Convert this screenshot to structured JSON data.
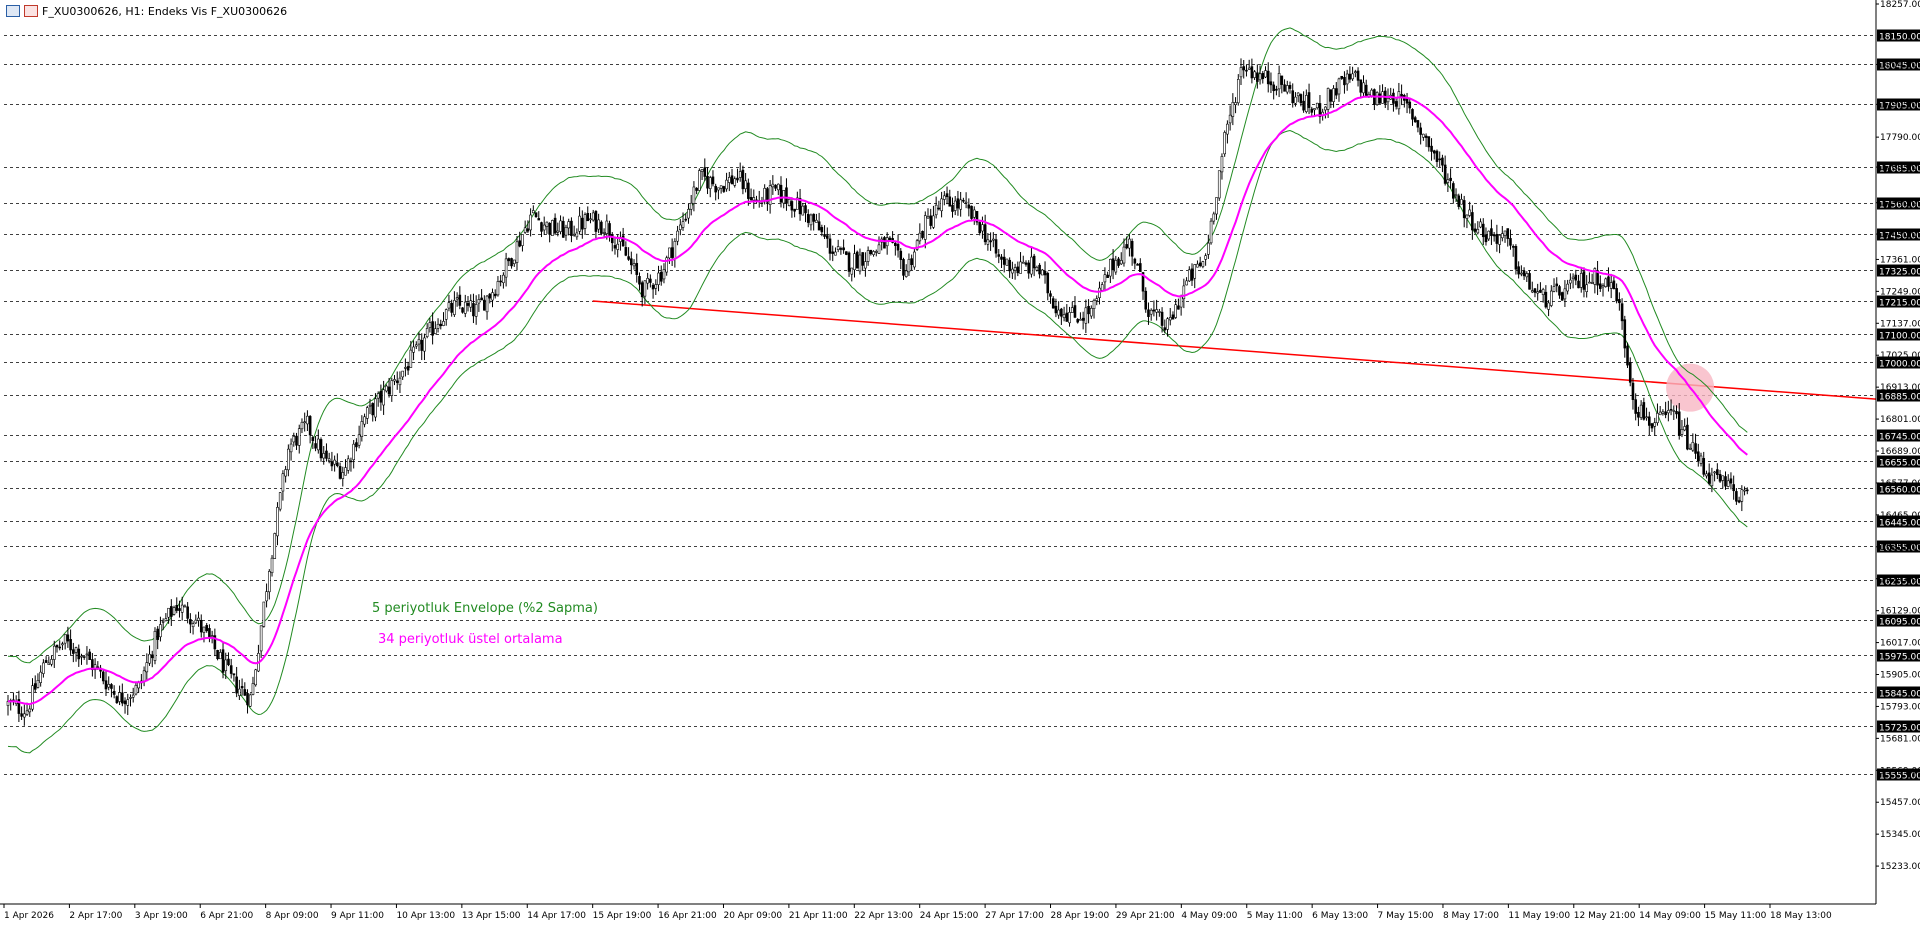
{
  "window": {
    "title": "F_XU0300626, H1:  Endeks Vis F_XU0300626",
    "icons": [
      "chart-icon",
      "indicator-icon"
    ]
  },
  "colors": {
    "candle": "#000000",
    "envelope": "#228b22",
    "ema": "#ff00ff",
    "trendline": "#ff0000",
    "highlight": "#f7b7c3",
    "legend_envelope": "#228b22",
    "legend_ema": "#ff00ff",
    "grid": "#000000"
  },
  "chart_data": {
    "type": "candlestick",
    "ylim": [
      15100,
      18257
    ],
    "grid": "dashed horizontal lines at key levels",
    "legend_placement": "lower-left (annotations)",
    "y_tick_labels": [
      "18257.00",
      "18045.00",
      "17905.00",
      "17790.00",
      "17685.00",
      "17560.00",
      "17450.00",
      "17361.00",
      "17249.00",
      "17137.00",
      "17025.00",
      "16913.00",
      "16801.00",
      "16689.00",
      "16577.00",
      "16465.00",
      "16353.00",
      "16241.00",
      "16129.00",
      "16017.00",
      "15905.00",
      "15793.00",
      "15681.00",
      "15569.00",
      "15457.00",
      "15345.00",
      "15233.00"
    ],
    "boxed_levels": [
      "18150.00",
      "18045.00",
      "17905.00",
      "17685.00",
      "17560.00",
      "17450.00",
      "17325.00",
      "17215.00",
      "17100.00",
      "17000.00",
      "16885.00",
      "16745.00",
      "16655.00",
      "16560.00",
      "16445.00",
      "16355.00",
      "16235.00",
      "16095.00",
      "15975.00",
      "15845.00",
      "15725.00",
      "15555.00"
    ],
    "x_tick_labels": [
      "1 Apr 2026",
      "2 Apr 17:00",
      "3 Apr 19:00",
      "6 Apr 21:00",
      "8 Apr 09:00",
      "9 Apr 11:00",
      "10 Apr 13:00",
      "13 Apr 15:00",
      "14 Apr 17:00",
      "15 Apr 19:00",
      "16 Apr 21:00",
      "20 Apr 09:00",
      "21 Apr 11:00",
      "22 Apr 13:00",
      "24 Apr 15:00",
      "27 Apr 17:00",
      "28 Apr 19:00",
      "29 Apr 21:00",
      "4 May 09:00",
      "5 May 11:00",
      "6 May 13:00",
      "7 May 15:00",
      "8 May 17:00",
      "11 May 19:00",
      "12 May 21:00",
      "14 May 09:00",
      "15 May 11:00",
      "18 May 13:00"
    ],
    "anchors": [
      15800,
      15780,
      15950,
      16020,
      15980,
      15900,
      15820,
      15860,
      16050,
      16150,
      16100,
      16000,
      15880,
      15820,
      16300,
      16700,
      16780,
      16650,
      16620,
      16800,
      16880,
      16960,
      17050,
      17150,
      17200,
      17180,
      17260,
      17380,
      17520,
      17470,
      17460,
      17500,
      17480,
      17380,
      17250,
      17320,
      17480,
      17650,
      17620,
      17650,
      17560,
      17600,
      17560,
      17500,
      17400,
      17350,
      17380,
      17420,
      17320,
      17480,
      17560,
      17550,
      17480,
      17360,
      17330,
      17340,
      17200,
      17160,
      17180,
      17340,
      17420,
      17180,
      17120,
      17280,
      17360,
      17760,
      18050,
      18000,
      17980,
      17920,
      17880,
      17960,
      18000,
      17920,
      17940,
      17880,
      17760,
      17640,
      17520,
      17450,
      17440,
      17300,
      17220,
      17240,
      17280,
      17300,
      17250,
      16850,
      16780,
      16820,
      16700,
      16600,
      16560,
      16520
    ],
    "ema_period": 34,
    "envelope_period": 5,
    "envelope_deviation_pct": 2,
    "trendline": {
      "from": {
        "x": "15 Apr 19:00",
        "y": 17215
      },
      "to": {
        "x": "18 May 13:00",
        "y": 16885
      }
    },
    "annotations": [
      {
        "text": "5 periyotluk Envelope (%2 Sapma)"
      },
      {
        "text": "34 periyotluk üstel ortalama"
      }
    ]
  }
}
